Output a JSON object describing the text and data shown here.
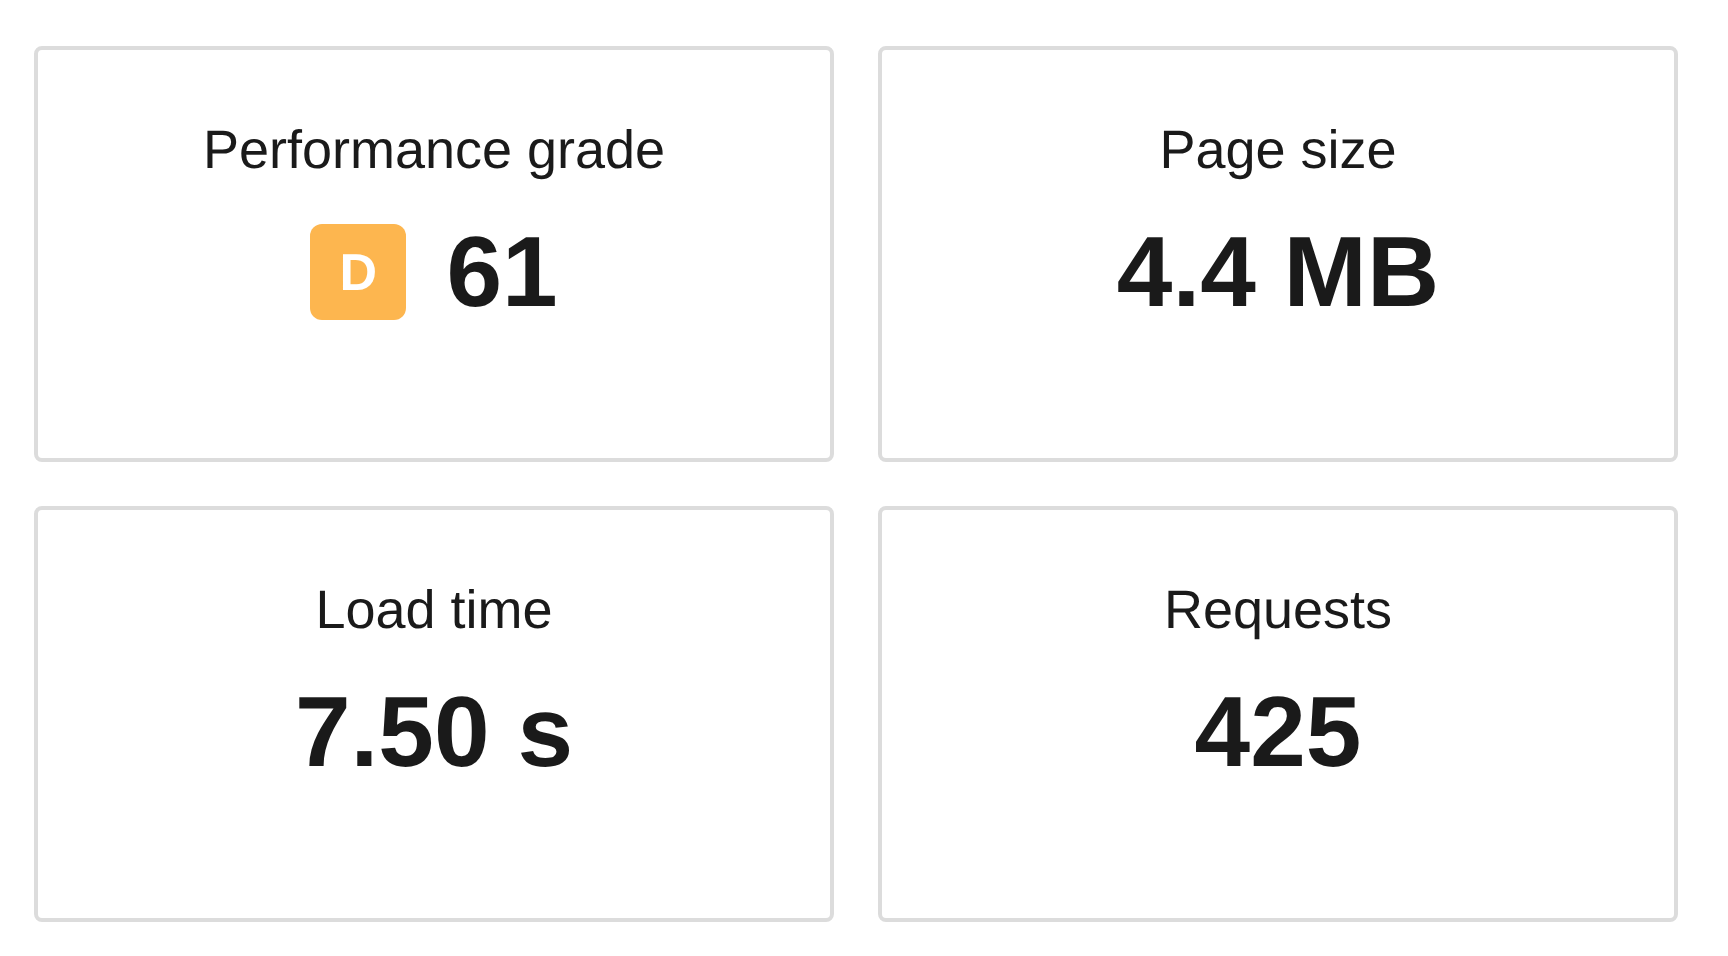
{
  "metrics": [
    {
      "label": "Performance grade",
      "value": "61",
      "grade": {
        "letter": "D",
        "color": "#fdb64f"
      }
    },
    {
      "label": "Page size",
      "value": "4.4 MB"
    },
    {
      "label": "Load time",
      "value": "7.50 s"
    },
    {
      "label": "Requests",
      "value": "425"
    }
  ]
}
